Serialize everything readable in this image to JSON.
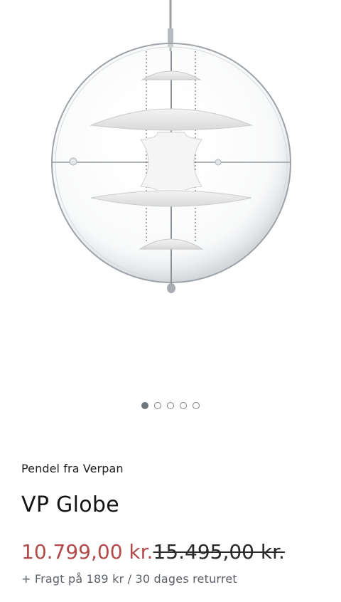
{
  "product": {
    "image_alt_icon": "globe-pendant-lamp",
    "carousel": {
      "total": 5,
      "active_index": 0
    },
    "subtitle": "Pendel fra Verpan",
    "title": "VP Globe",
    "price_sale": "10.799,00 kr.",
    "price_original": "15.495,00 kr.",
    "shipping_text": "+ Fragt på 189 kr / 30 dages returret"
  },
  "colors": {
    "sale_price": "#b34a4a",
    "dot_active": "#6f757d",
    "text_muted": "#5c6068"
  }
}
